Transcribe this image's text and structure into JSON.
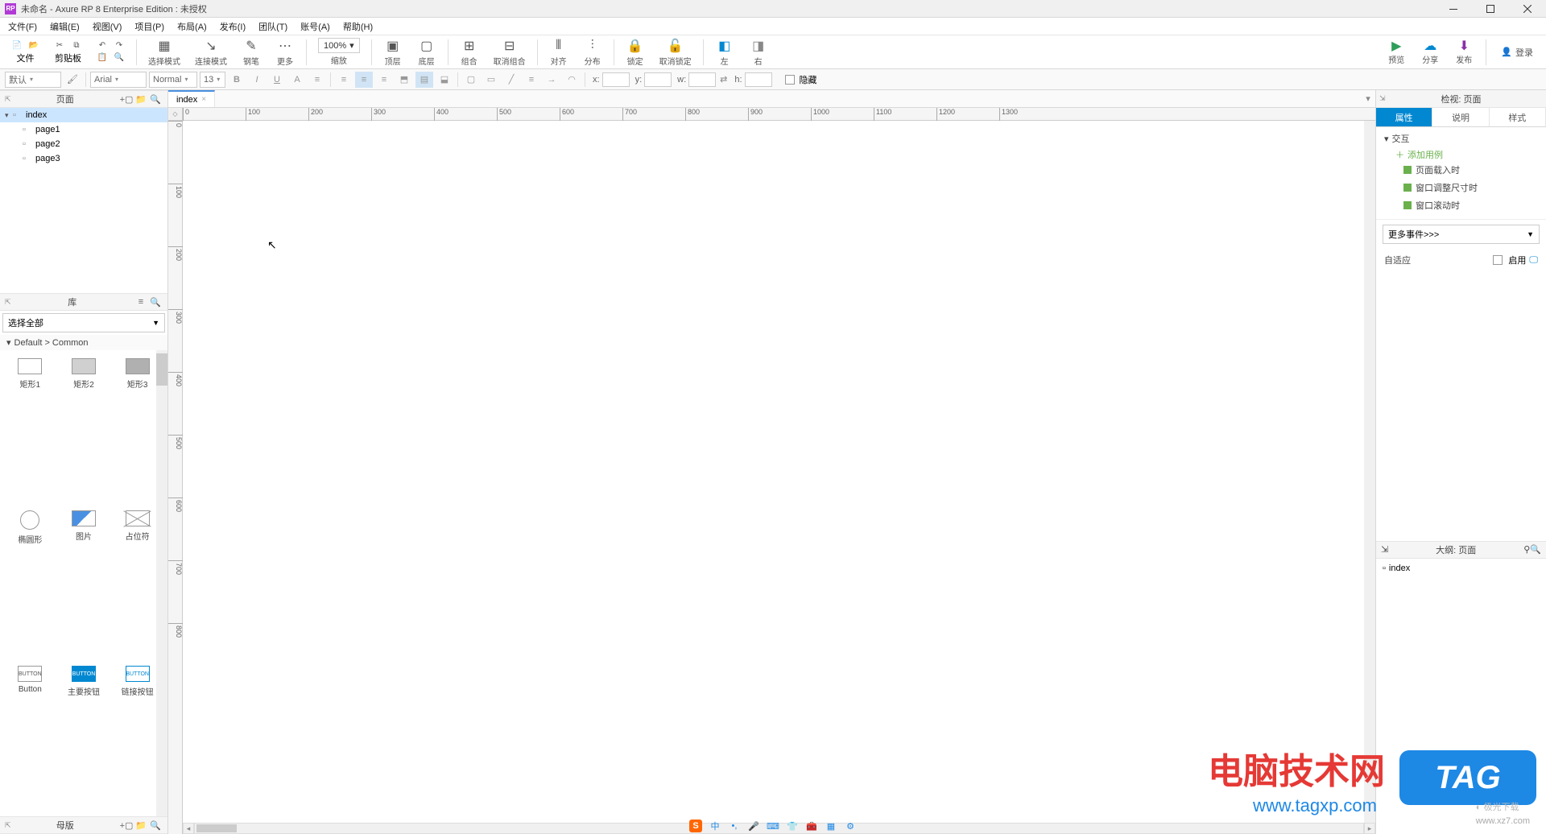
{
  "titlebar": {
    "app_icon_text": "RP",
    "title": "未命名 - Axure RP 8 Enterprise Edition : 未授权"
  },
  "menubar": {
    "items": [
      "文件(F)",
      "编辑(E)",
      "视图(V)",
      "项目(P)",
      "布局(A)",
      "发布(I)",
      "团队(T)",
      "账号(A)",
      "帮助(H)"
    ]
  },
  "maintb": {
    "file_label": "文件",
    "clipboard_label": "剪贴板",
    "select_mode_label": "选择模式",
    "connect_mode_label": "连接模式",
    "pen_label": "钢笔",
    "more_label": "更多",
    "zoom_value": "100%",
    "zoom_label": "缩放",
    "top_label": "顶层",
    "bottom_label": "底层",
    "group_label": "组合",
    "ungroup_label": "取消组合",
    "align_label": "对齐",
    "distribute_label": "分布",
    "lock_label": "锁定",
    "unlock_label": "取消锁定",
    "left_label": "左",
    "right_label": "右",
    "preview_label": "预览",
    "share_label": "分享",
    "publish_label": "发布",
    "login_label": "登录"
  },
  "fmttb": {
    "style_default": "默认",
    "font_name": "Arial",
    "font_weight": "Normal",
    "font_size": "13",
    "x_label": "x:",
    "y_label": "y:",
    "w_label": "w:",
    "h_label": "h:",
    "hidden_label": "隐藏"
  },
  "pages_panel": {
    "title": "页面",
    "root": "index",
    "children": [
      "page1",
      "page2",
      "page3"
    ]
  },
  "lib_panel": {
    "title": "库",
    "selector": "选择全部",
    "category": "Default > Common",
    "items": [
      {
        "label": "矩形1",
        "shape": "rect"
      },
      {
        "label": "矩形2",
        "shape": "rect-filled"
      },
      {
        "label": "矩形3",
        "shape": "rect-dark"
      },
      {
        "label": "椭圆形",
        "shape": "circle"
      },
      {
        "label": "图片",
        "shape": "img"
      },
      {
        "label": "占位符",
        "shape": "ph"
      },
      {
        "label": "Button",
        "shape": "btn1",
        "text": "BUTTON"
      },
      {
        "label": "主要按钮",
        "shape": "btn2",
        "text": "BUTTON"
      },
      {
        "label": "链接按钮",
        "shape": "btn3",
        "text": "BUTTON"
      }
    ]
  },
  "master_panel": {
    "title": "母版"
  },
  "doc_tabs": {
    "active": "index"
  },
  "ruler_h": [
    "0",
    "100",
    "200",
    "300",
    "400",
    "500",
    "600",
    "700",
    "800",
    "900",
    "1000",
    "1100",
    "1200",
    "1300"
  ],
  "ruler_v": [
    "0",
    "100",
    "200",
    "300",
    "400",
    "500",
    "600",
    "700",
    "800"
  ],
  "right_panel": {
    "header": "检视: 页面",
    "tabs": [
      "属性",
      "说明",
      "样式"
    ],
    "active_tab": 0,
    "interaction_label": "交互",
    "add_case_label": "添加用例",
    "events": [
      "页面载入时",
      "窗口调整尺寸时",
      "窗口滚动时"
    ],
    "more_events_label": "更多事件>>>",
    "adaptive_label": "自适应",
    "enable_label": "启用"
  },
  "outline_panel": {
    "title": "大纲: 页面",
    "root": "index"
  },
  "watermarks": {
    "brand_cn": "电脑技术网",
    "brand_url": "www.tagxp.com",
    "tag_badge": "TAG",
    "site2": "www.xz7.com"
  }
}
